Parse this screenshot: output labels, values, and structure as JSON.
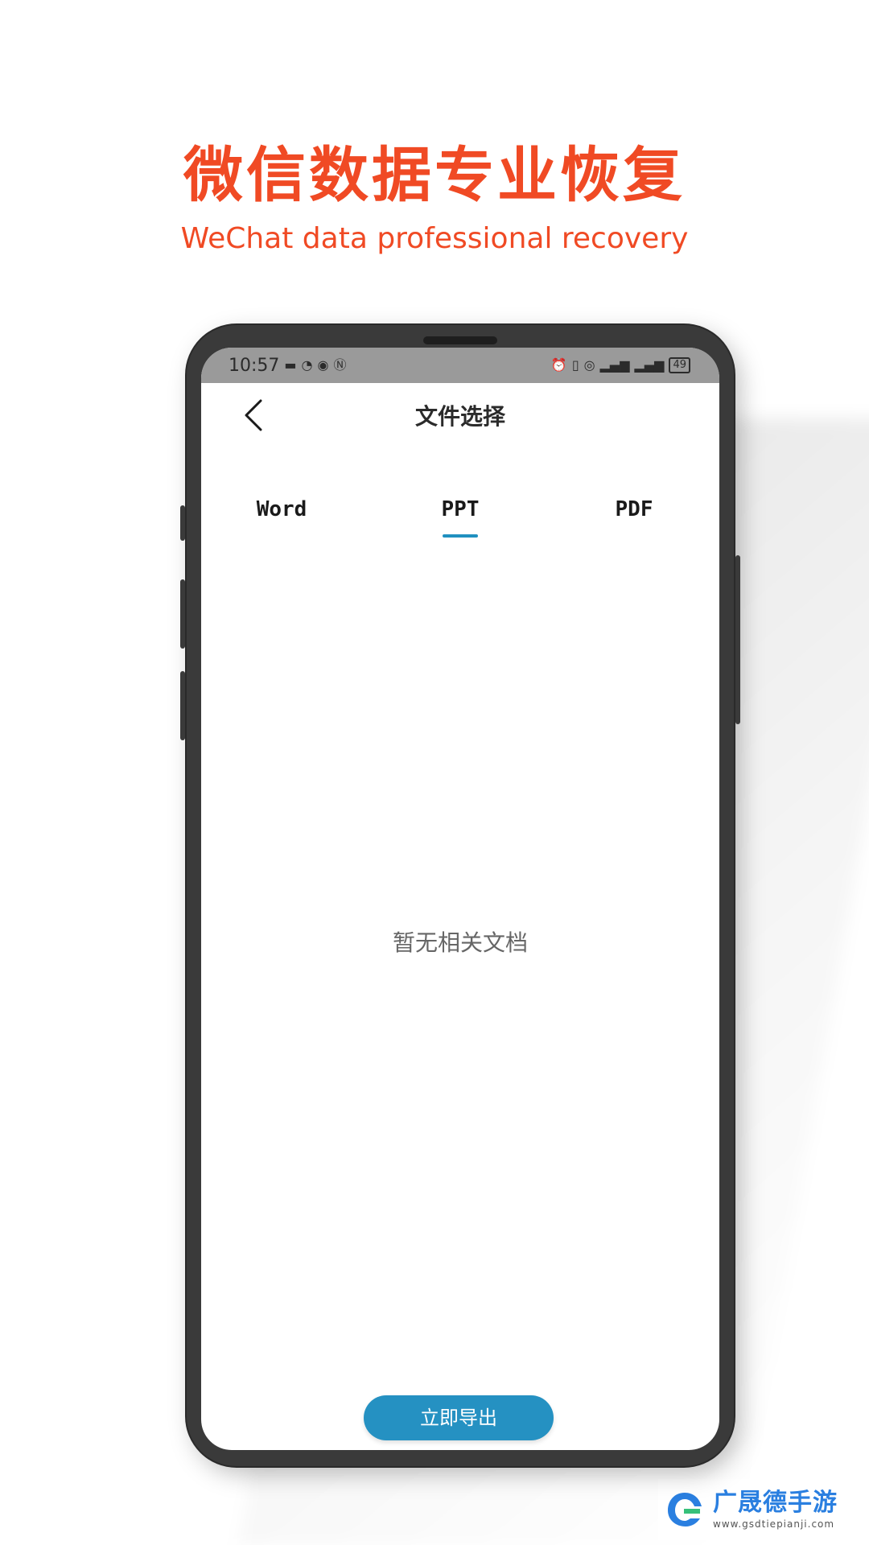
{
  "hero": {
    "title": "微信数据专业恢复",
    "subtitle": "WeChat data professional recovery"
  },
  "status_bar": {
    "time": "10:57",
    "battery": "49"
  },
  "header": {
    "title": "文件选择"
  },
  "tabs": [
    {
      "label": "Word",
      "selected": false
    },
    {
      "label": "PPT",
      "selected": true
    },
    {
      "label": "PDF",
      "selected": false
    }
  ],
  "empty_state": {
    "message": "暂无相关文档"
  },
  "actions": {
    "export_label": "立即导出"
  },
  "watermark": {
    "title": "广晟德手游",
    "url": "www.gsdtiepianji.com"
  },
  "colors": {
    "hero": "#f04a24",
    "accent": "#2591c2",
    "tab_indicator": "#2090c0",
    "phone_frame": "#3a3a3a",
    "status_bar": "#9a9a9a"
  }
}
